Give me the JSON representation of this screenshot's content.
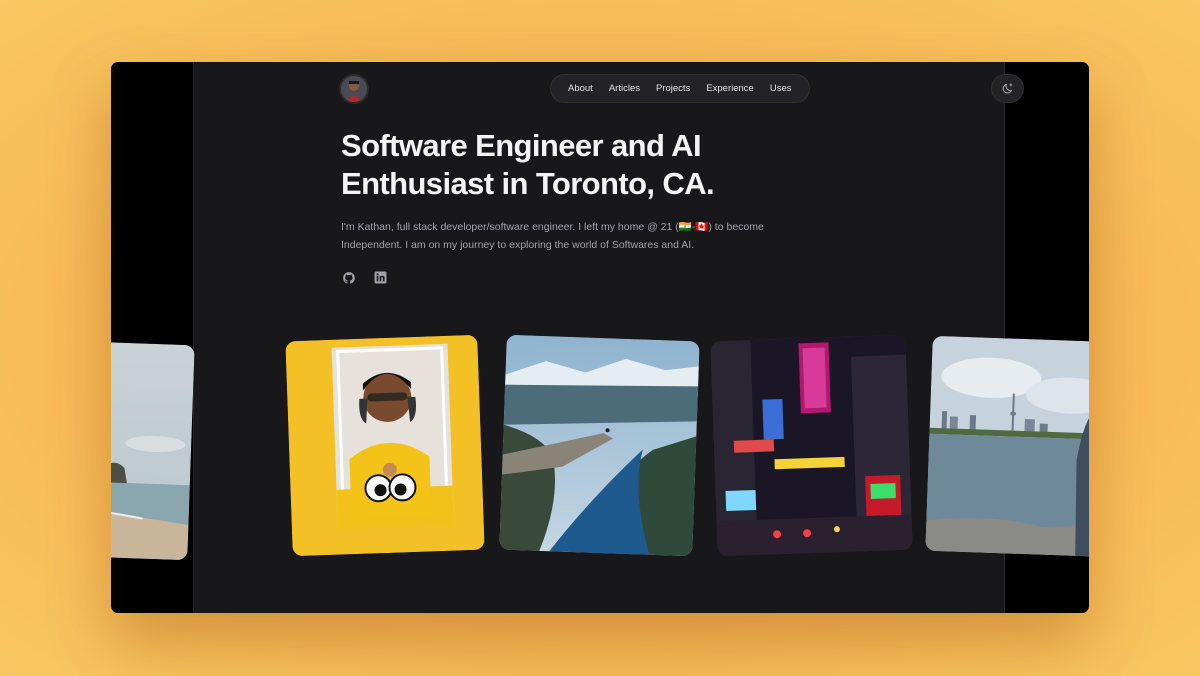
{
  "header": {
    "nav": [
      "About",
      "Articles",
      "Projects",
      "Experience",
      "Uses"
    ],
    "theme_icon": "moon-sparkle-icon",
    "avatar_icon": "profile-avatar"
  },
  "hero": {
    "headline_line1": "Software Engineer and AI",
    "headline_line2": "Enthusiast in Toronto, CA.",
    "bio": "I'm Kathan, full stack developer/software engineer. I left my home @ 21 (🇮🇳-🇨🇦) to become Independent. I am on my journey to exploring the world of Softwares and AI.",
    "socials": [
      "github-icon",
      "linkedin-icon"
    ]
  },
  "photos": [
    {
      "name": "beach-cliffs-photo"
    },
    {
      "name": "selfie-headphones-photo"
    },
    {
      "name": "fjord-cliff-photo"
    },
    {
      "name": "neon-city-street-photo"
    },
    {
      "name": "toronto-skyline-photo"
    }
  ],
  "colors": {
    "page_bg": "#18181b",
    "outer_bg": "#000000",
    "text_primary": "#f4f4f5",
    "text_muted": "#a1a1aa",
    "backdrop": "#f6b452"
  }
}
